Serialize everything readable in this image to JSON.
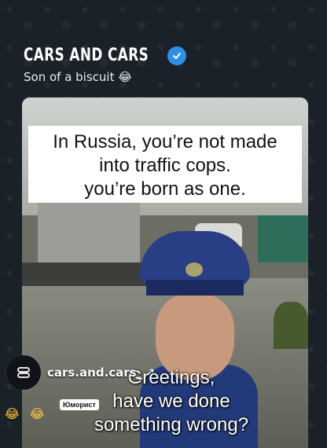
{
  "channel": {
    "name": "CARS AND CARS",
    "verified": true,
    "caption": "Son of a biscuit",
    "caption_emoji": "😂"
  },
  "video": {
    "overlay_lines": [
      "In Russia, you’re not made",
      "into traffic cops.",
      "you’re born  as one."
    ],
    "subtitle_lines": [
      "Greetings,",
      "have we done",
      "something wrong?"
    ],
    "badge": "Юморист"
  },
  "post": {
    "handle": "cars.and.cars_",
    "handle_icon": "external-link-icon"
  },
  "reactions": [
    "😂",
    "😂"
  ],
  "colors": {
    "background": "#1b2128",
    "verified": "#2f8fe8"
  }
}
